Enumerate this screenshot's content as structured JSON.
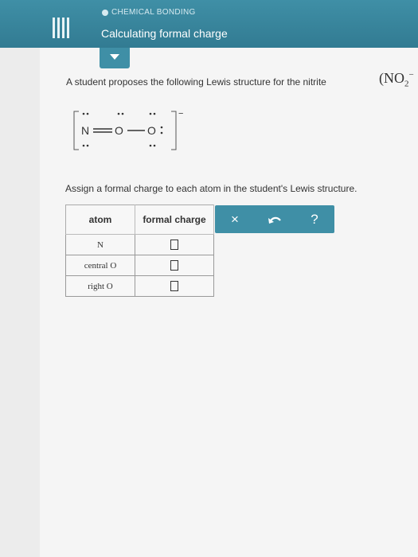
{
  "header": {
    "category": "CHEMICAL BONDING",
    "title": "Calculating formal charge"
  },
  "question": {
    "prompt": "A student proposes the following Lewis structure for the nitrite",
    "formula_base": "NO",
    "formula_sub": "2",
    "formula_sup": "−",
    "instruction": "Assign a formal charge to each atom in the student's Lewis structure."
  },
  "lewis": {
    "atom1": "N",
    "atom2": "O",
    "atom3": "O",
    "charge": "−"
  },
  "table": {
    "headers": [
      "atom",
      "formal charge"
    ],
    "rows": [
      {
        "atom": "N"
      },
      {
        "atom": "central O"
      },
      {
        "atom": "right O"
      }
    ]
  },
  "toolbar": {
    "clear_label": "×",
    "help_label": "?"
  },
  "colors": {
    "header": "#3f8fa6",
    "background": "#ececec"
  }
}
